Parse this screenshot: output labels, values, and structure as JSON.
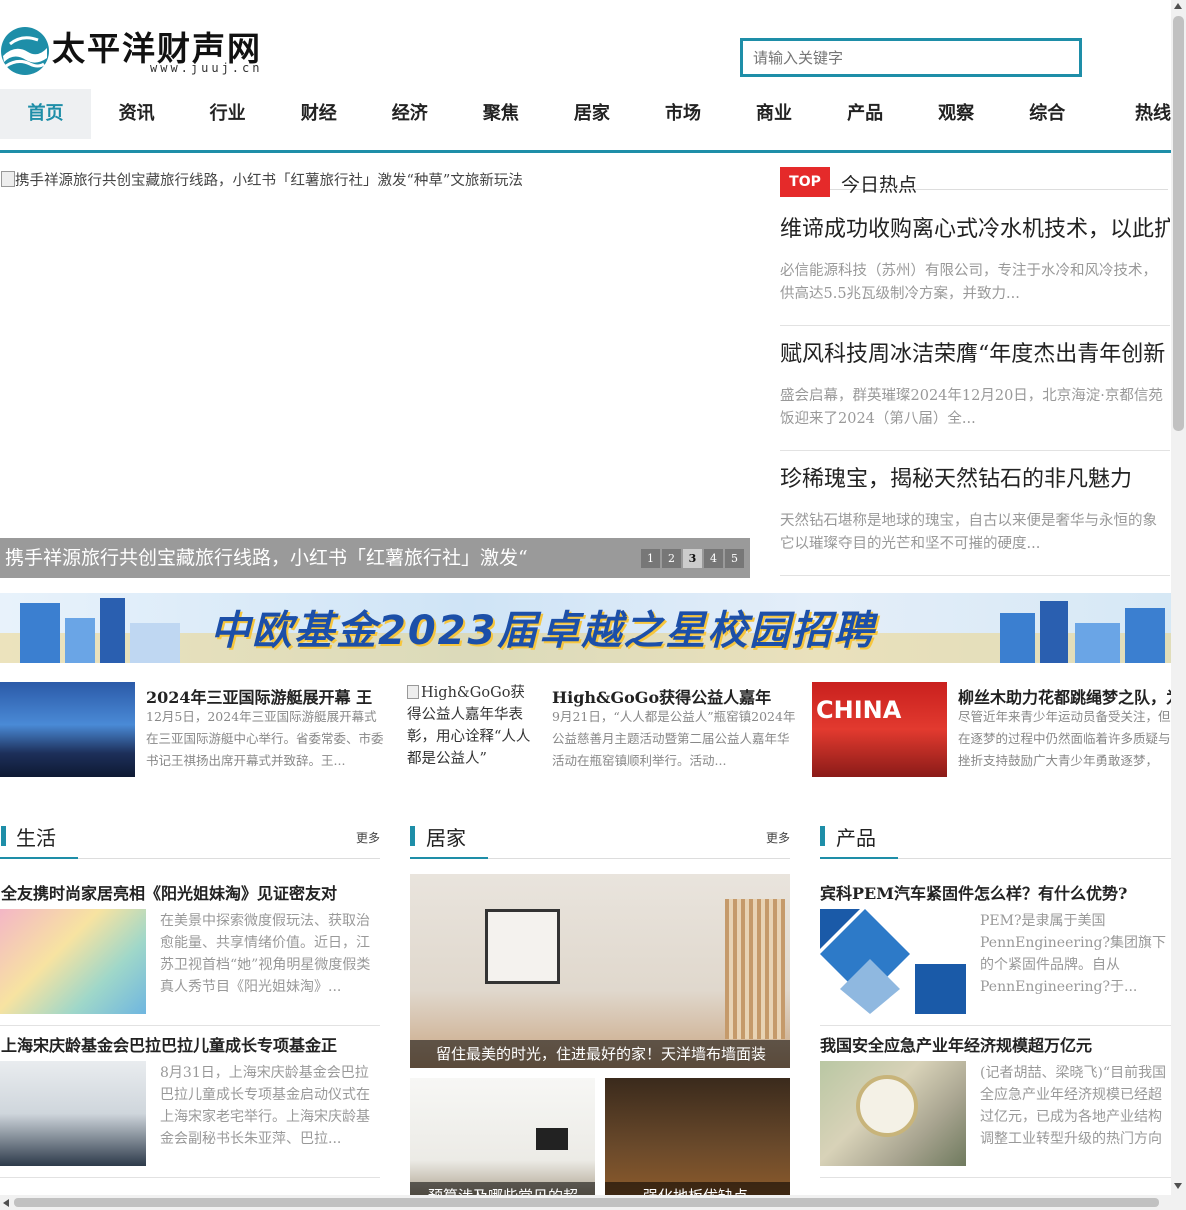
{
  "header": {
    "logo_name": "太平洋财声网",
    "logo_url": "www.juuj.cn",
    "search_placeholder": "请输入关键字"
  },
  "nav": [
    "首页",
    "资讯",
    "行业",
    "财经",
    "经济",
    "聚焦",
    "居家",
    "市场",
    "商业",
    "产品",
    "观察",
    "综合",
    "热线"
  ],
  "slider": {
    "image_alt": "携手祥源旅行共创宝藏旅行线路，小红书「红薯旅行社」激发“种草”文旅新玩法",
    "caption": "携手祥源旅行共创宝藏旅行线路，小红书「红薯旅行社」激发“",
    "pages": [
      "1",
      "2",
      "3",
      "4",
      "5"
    ],
    "current_page": "3"
  },
  "hot": {
    "badge": "TOP",
    "heading": "今日热点",
    "items": [
      {
        "title": "维谛成功收购离心式冷水机技术，以此扩",
        "desc": "必信能源科技（苏州）有限公司，专注于水冷和风冷技术，供高达5.5兆瓦级制冷方案，并致力..."
      },
      {
        "title": "赋风科技周冰洁荣膺“年度杰出青年创新",
        "desc": "盛会启幕，群英璀璨2024年12月20日，北京海淀·京都信苑饭迎来了2024（第八届）全..."
      },
      {
        "title": "珍稀瑰宝，揭秘天然钻石的非凡魅力",
        "desc": "天然钻石堪称是地球的瑰宝，自古以来便是奢华与永恒的象它以璀璨夺目的光芒和坚不可摧的硬度..."
      }
    ]
  },
  "banner": {
    "text": "中欧基金2023届卓越之星校园招聘"
  },
  "cards": [
    {
      "title": "2024年三亚国际游艇展开幕 王",
      "desc": "12月5日，2024年三亚国际游艇展开幕式在三亚国际游艇中心举行。省委常委、市委书记王祺扬出席开幕式并致辞。王..."
    },
    {
      "image_alt": "High&GoGo获得公益人嘉年华表彰，用心诠释“人人都是公益人”",
      "title": "High&GoGo获得公益人嘉年",
      "desc": "9月21日，“人人都是公益人”瓶窑镇2024年公益慈善月主题活动暨第二届公益人嘉年华活动在瓶窑镇顺利举行。活动..."
    },
    {
      "title": "柳丝木助力花都跳绳梦之队，为少",
      "desc": "尽管近年来青少年运动员备受关注，但在逐梦的过程中仍然面临着许多质疑与挫折支持鼓励广大青少年勇敢逐梦，柳..."
    }
  ],
  "sections": {
    "life": {
      "title": "生活",
      "more": "更多",
      "articles": [
        {
          "title": "全友携时尚家居亮相《阳光姐妹淘》见证密友对",
          "desc": "在美景中探索微度假玩法、获取治愈能量、共享情绪价值。近日，江苏卫视首档“她”视角明星微度假类真人秀节目《阳光姐妹淘》..."
        },
        {
          "title": "上海宋庆龄基金会巴拉巴拉儿童成长专项基金正",
          "desc": "8月31日，上海宋庆龄基金会巴拉巴拉儿童成长专项基金启动仪式在上海宋家老宅举行。上海宋庆龄基金会副秘书长朱亚萍、巴拉..."
        }
      ]
    },
    "home": {
      "title": "居家",
      "more": "更多",
      "main_caption": "留住最美的时光，住进最好的家！天洋墙布墙面装",
      "sub1_caption": "预算涉及哪些常见的超",
      "sub2_caption": "强化地板优缺点"
    },
    "product": {
      "title": "产品",
      "articles": [
        {
          "title": "宾科PEM汽车紧固件怎么样？有什么优势?",
          "desc": "PEM?是隶属于美国PennEngineering?集团旗下的个紧固件品牌。自从PennEngineering?于..."
        },
        {
          "title": "我国安全应急产业年经济规模超万亿元",
          "desc": "(记者胡喆、梁晓飞)“目前我国全应急产业年经济规模已经超过亿元，已成为各地产业结构调整工业转型升级的热门方向之..."
        }
      ]
    }
  },
  "colors": {
    "accent": "#1e8ea8",
    "top_badge": "#e52a2a"
  }
}
